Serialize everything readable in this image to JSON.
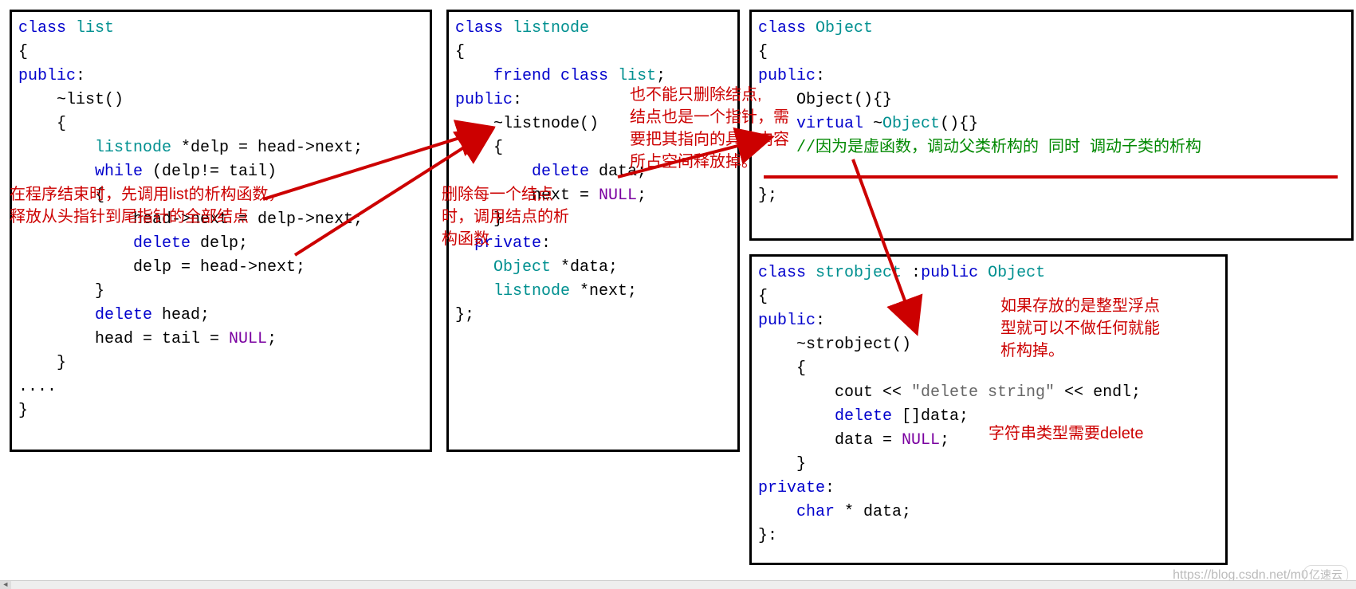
{
  "boxes": {
    "list": {
      "tokens": [
        [
          [
            "class ",
            "kw"
          ],
          [
            "list",
            "type"
          ]
        ],
        [
          [
            "{",
            ""
          ]
        ],
        [
          [
            "public",
            "kw"
          ],
          [
            ":",
            ""
          ]
        ],
        [
          [
            "    ~list()",
            ""
          ]
        ],
        [
          [
            "    {",
            ""
          ]
        ],
        [
          [
            "        ",
            ""
          ],
          [
            "listnode",
            "type"
          ],
          [
            " *delp = head->next;",
            ""
          ]
        ],
        [
          [
            "        ",
            ""
          ],
          [
            "while",
            "kw"
          ],
          [
            " (delp!= tail)",
            ""
          ]
        ],
        [
          [
            "        {",
            ""
          ]
        ],
        [
          [
            "            head->next = delp->next;",
            ""
          ]
        ],
        [
          [
            "            ",
            ""
          ],
          [
            "delete",
            "kw"
          ],
          [
            " delp;",
            ""
          ]
        ],
        [
          [
            "            delp = head->next;",
            ""
          ]
        ],
        [
          [
            "        }",
            ""
          ]
        ],
        [
          [
            "        ",
            ""
          ],
          [
            "delete",
            "kw"
          ],
          [
            " head;",
            ""
          ]
        ],
        [
          [
            "        head = tail = ",
            ""
          ],
          [
            "NULL",
            "macro"
          ],
          [
            ";",
            ""
          ]
        ],
        [
          [
            "    }",
            ""
          ]
        ],
        [
          [
            "....",
            ""
          ]
        ],
        [
          [
            "}",
            ""
          ]
        ]
      ]
    },
    "listnode": {
      "tokens": [
        [
          [
            "class ",
            "kw"
          ],
          [
            "listnode",
            "type"
          ]
        ],
        [
          [
            "{",
            ""
          ]
        ],
        [
          [
            "    ",
            ""
          ],
          [
            "friend",
            "kw"
          ],
          [
            " ",
            ""
          ],
          [
            "class",
            "kw"
          ],
          [
            " ",
            ""
          ],
          [
            "list",
            "type"
          ],
          [
            ";",
            ""
          ]
        ],
        [
          [
            "public",
            "kw"
          ],
          [
            ":",
            ""
          ]
        ],
        [
          [
            "    ~listnode()",
            ""
          ]
        ],
        [
          [
            "    {",
            ""
          ]
        ],
        [
          [
            "        ",
            ""
          ],
          [
            "delete",
            "kw"
          ],
          [
            " data;",
            ""
          ]
        ],
        [
          [
            "        next = ",
            ""
          ],
          [
            "NULL",
            "macro"
          ],
          [
            ";",
            ""
          ]
        ],
        [
          [
            "    }",
            ""
          ]
        ],
        [
          [
            "  ",
            ""
          ],
          [
            "private",
            "kw"
          ],
          [
            ":",
            ""
          ]
        ],
        [
          [
            "    ",
            ""
          ],
          [
            "Object",
            "type"
          ],
          [
            " *data;",
            ""
          ]
        ],
        [
          [
            "    ",
            ""
          ],
          [
            "listnode",
            "type"
          ],
          [
            " *next;",
            ""
          ]
        ],
        [
          [
            "};",
            ""
          ]
        ]
      ]
    },
    "object": {
      "tokens": [
        [
          [
            "class ",
            "kw"
          ],
          [
            "Object",
            "type"
          ]
        ],
        [
          [
            "{",
            ""
          ]
        ],
        [
          [
            "public",
            "kw"
          ],
          [
            ":",
            ""
          ]
        ],
        [
          [
            "    Object(){}",
            ""
          ]
        ],
        [
          [
            "    ",
            ""
          ],
          [
            "virtual",
            "kw"
          ],
          [
            " ~",
            ""
          ],
          [
            "Object",
            "type"
          ],
          [
            "(){}",
            ""
          ]
        ],
        [
          [
            "    ",
            ""
          ],
          [
            "//因为是虚函数，调动父类析构的 同时 调动子类的析构",
            "cmt"
          ]
        ],
        [
          [
            "",
            ""
          ]
        ],
        [
          [
            "};",
            ""
          ]
        ]
      ]
    },
    "strobject": {
      "tokens": [
        [
          [
            "class ",
            "kw"
          ],
          [
            "strobject",
            "type"
          ],
          [
            " :",
            ""
          ],
          [
            "public",
            "kw"
          ],
          [
            " ",
            ""
          ],
          [
            "Object",
            "type"
          ]
        ],
        [
          [
            "{",
            ""
          ]
        ],
        [
          [
            "public",
            "kw"
          ],
          [
            ":",
            ""
          ]
        ],
        [
          [
            "    ~strobject()",
            ""
          ]
        ],
        [
          [
            "    {",
            ""
          ]
        ],
        [
          [
            "        cout << ",
            ""
          ],
          [
            "\"delete string\"",
            "str"
          ],
          [
            " << endl;",
            ""
          ]
        ],
        [
          [
            "        ",
            ""
          ],
          [
            "delete",
            "kw"
          ],
          [
            " []data;",
            ""
          ]
        ],
        [
          [
            "        data = ",
            ""
          ],
          [
            "NULL",
            "macro"
          ],
          [
            ";",
            ""
          ]
        ],
        [
          [
            "    }",
            ""
          ]
        ],
        [
          [
            "private",
            "kw"
          ],
          [
            ":",
            ""
          ]
        ],
        [
          [
            "    ",
            ""
          ],
          [
            "char",
            "kw"
          ],
          [
            " * data;",
            ""
          ]
        ],
        [
          [
            "}:",
            ""
          ]
        ]
      ]
    }
  },
  "annotations": {
    "a1": "在程序结束时，先调用list的析构函数，\n释放从头指针到尾指针的全部结点",
    "a2": "删除每一个结点\n时，调用结点的析\n构函数",
    "a3": "也不能只删除结点,\n结点也是一个指针，需\n要把其指向的具体内容\n所占空间释放掉。",
    "a4": "如果存放的是整型浮点\n型就可以不做任何就能\n析构掉。",
    "a5": "字符串类型需要delete"
  },
  "watermark": "https://blog.csdn.net/m0",
  "logo": "亿速云"
}
